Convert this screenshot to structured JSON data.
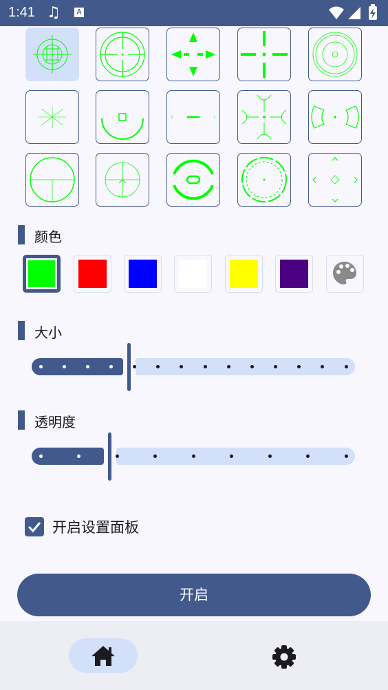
{
  "status_bar": {
    "time": "1:41",
    "notification_icons": [
      "music-note-icon",
      "a-box-icon"
    ],
    "system_icons": [
      "wifi-icon",
      "signal-icon",
      "battery-charging-icon"
    ]
  },
  "crosshair_grid": {
    "selected_index": 0,
    "accent_color": "#00ff00",
    "items": [
      "crosshair-circle-dense-icon",
      "crosshair-circle-scope-icon",
      "crosshair-arrows-icon",
      "crosshair-cross-dot-icon",
      "crosshair-concentric-rings-icon",
      "crosshair-star-lines-icon",
      "crosshair-arc-square-icon",
      "crosshair-dash-icon",
      "crosshair-curved-cross-icon",
      "crosshair-bracket-arcs-icon",
      "crosshair-circle-plus-icon",
      "crosshair-chevron-circle-icon",
      "crosshair-thick-arcs-icon",
      "crosshair-dashed-circle-icon",
      "crosshair-diamond-chevrons-icon"
    ]
  },
  "color_section": {
    "title": "颜色",
    "selected_index": 0,
    "swatches": [
      {
        "name": "green",
        "hex": "#00ff00"
      },
      {
        "name": "red",
        "hex": "#ff0000"
      },
      {
        "name": "blue",
        "hex": "#0000ff"
      },
      {
        "name": "white",
        "hex": "#ffffff"
      },
      {
        "name": "yellow",
        "hex": "#ffff00"
      },
      {
        "name": "purple",
        "hex": "#4b0082"
      }
    ],
    "custom_icon": "palette-icon"
  },
  "size_section": {
    "title": "大小",
    "value_fraction": 0.3,
    "active_dots": 4,
    "inactive_dots": 10
  },
  "opacity_section": {
    "title": "透明度",
    "value_fraction": 0.24,
    "active_dots": 2,
    "inactive_dots": 7
  },
  "settings_panel_checkbox": {
    "label": "开启设置面板",
    "checked": true
  },
  "start_button": {
    "label": "开启"
  },
  "bottom_nav": {
    "items": [
      {
        "icon": "home-icon",
        "selected": true
      },
      {
        "icon": "gear-icon",
        "selected": false
      }
    ]
  },
  "colors": {
    "primary": "#42598c",
    "primary_container": "#d3e0f9",
    "background": "#f8f7fd",
    "nav_background": "#eceef4"
  }
}
